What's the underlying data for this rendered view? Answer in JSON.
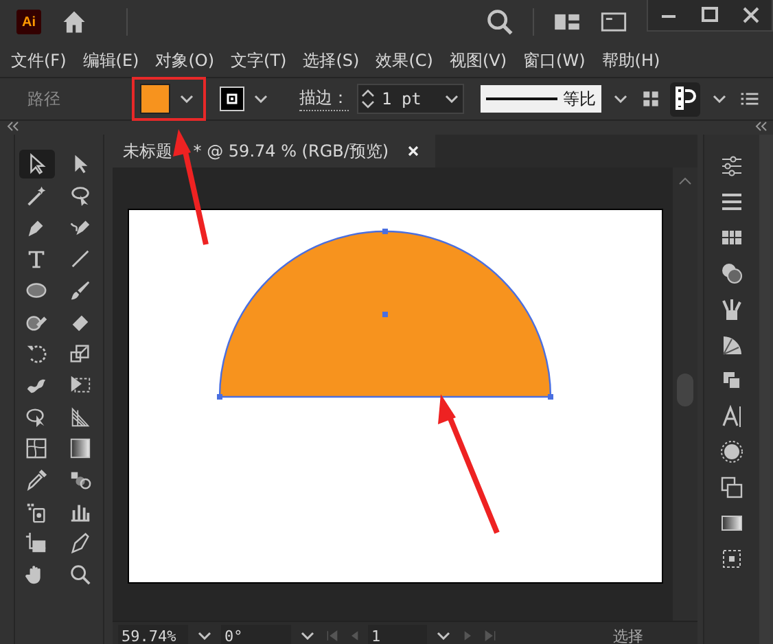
{
  "title_bar": {
    "app_logo": "Ai"
  },
  "menu": [
    "文件(F)",
    "编辑(E)",
    "对象(O)",
    "文字(T)",
    "选择(S)",
    "效果(C)",
    "视图(V)",
    "窗口(W)",
    "帮助(H)"
  ],
  "control_bar": {
    "object_type": "路径",
    "stroke_label": "描边：",
    "stroke_weight": "1 pt",
    "stroke_profile": "等比"
  },
  "tools": [
    {
      "selected": true
    },
    {
      "selected": false
    },
    {
      "selected": false
    },
    {
      "selected": false
    },
    {
      "selected": false
    },
    {
      "selected": false
    },
    {
      "selected": false
    },
    {
      "selected": false
    },
    {
      "selected": false
    },
    {
      "selected": false
    },
    {
      "selected": false
    },
    {
      "selected": false
    },
    {
      "selected": false
    },
    {
      "selected": false
    },
    {
      "selected": false
    },
    {
      "selected": false
    },
    {
      "selected": false
    },
    {
      "selected": false
    },
    {
      "selected": false
    },
    {
      "selected": false
    },
    {
      "selected": false
    },
    {
      "selected": false
    },
    {
      "selected": false
    },
    {
      "selected": false
    },
    {
      "selected": false
    },
    {
      "selected": false
    },
    {
      "selected": false
    },
    {
      "selected": false
    }
  ],
  "document_tab": {
    "title": "未标题    * @ 59.74 % (RGB/预览)"
  },
  "status_bar": {
    "zoom": "59.74%",
    "rotation": "0°",
    "artboard": "1",
    "current_tool": "选择"
  }
}
